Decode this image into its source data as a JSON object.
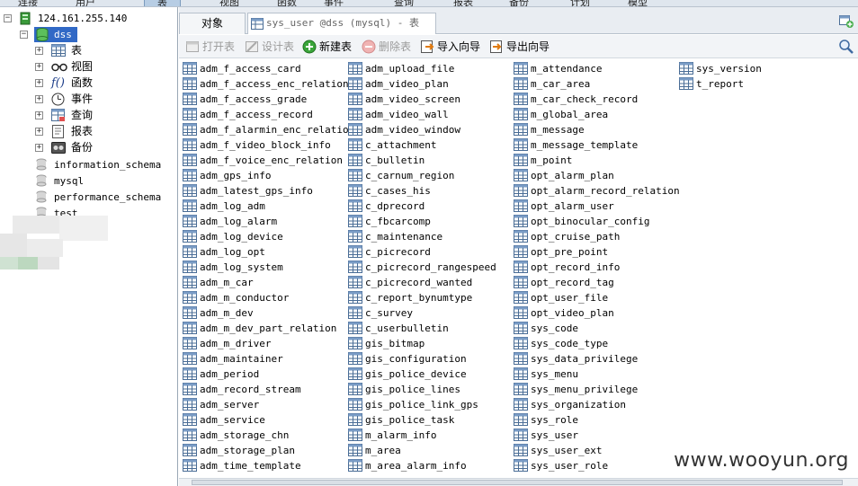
{
  "menu": [
    "连接",
    "用户",
    "表",
    "视图",
    "函数",
    "事件",
    "查询",
    "报表",
    "备份",
    "计划",
    "模型"
  ],
  "tree": {
    "server": "124.161.255.140",
    "database": "dss",
    "children": [
      "表",
      "视图",
      "函数",
      "事件",
      "查询",
      "报表",
      "备份"
    ],
    "other_dbs": [
      "information_schema",
      "mysql",
      "performance_schema",
      "test"
    ]
  },
  "tabs": {
    "objects": "对象",
    "active": "sys_user @dss (mysql) - 表"
  },
  "toolbar": {
    "open": "打开表",
    "design": "设计表",
    "new": "新建表",
    "delete": "删除表",
    "import": "导入向导",
    "export": "导出向导"
  },
  "columns": [
    [
      "adm_f_access_card",
      "adm_f_access_enc_relation",
      "adm_f_access_grade",
      "adm_f_access_record",
      "adm_f_alarmin_enc_relation",
      "adm_f_video_block_info",
      "adm_f_voice_enc_relation",
      "adm_gps_info",
      "adm_latest_gps_info",
      "adm_log_adm",
      "adm_log_alarm",
      "adm_log_device",
      "adm_log_opt",
      "adm_log_system",
      "adm_m_car",
      "adm_m_conductor",
      "adm_m_dev",
      "adm_m_dev_part_relation",
      "adm_m_driver",
      "adm_maintainer",
      "adm_period",
      "adm_record_stream",
      "adm_server",
      "adm_service",
      "adm_storage_chn",
      "adm_storage_plan",
      "adm_time_template"
    ],
    [
      "adm_upload_file",
      "adm_video_plan",
      "adm_video_screen",
      "adm_video_wall",
      "adm_video_window",
      "c_attachment",
      "c_bulletin",
      "c_carnum_region",
      "c_cases_his",
      "c_dprecord",
      "c_fbcarcomp",
      "c_maintenance",
      "c_picrecord",
      "c_picrecord_rangespeed",
      "c_picrecord_wanted",
      "c_report_bynumtype",
      "c_survey",
      "c_userbulletin",
      "gis_bitmap",
      "gis_configuration",
      "gis_police_device",
      "gis_police_lines",
      "gis_police_link_gps",
      "gis_police_task",
      "m_alarm_info",
      "m_area",
      "m_area_alarm_info"
    ],
    [
      "m_attendance",
      "m_car_area",
      "m_car_check_record",
      "m_global_area",
      "m_message",
      "m_message_template",
      "m_point",
      "opt_alarm_plan",
      "opt_alarm_record_relation",
      "opt_alarm_user",
      "opt_binocular_config",
      "opt_cruise_path",
      "opt_pre_point",
      "opt_record_info",
      "opt_record_tag",
      "opt_user_file",
      "opt_video_plan",
      "sys_code",
      "sys_code_type",
      "sys_data_privilege",
      "sys_menu",
      "sys_menu_privilege",
      "sys_organization",
      "sys_role",
      "sys_user",
      "sys_user_ext",
      "sys_user_role"
    ],
    [
      "sys_version",
      "t_report"
    ]
  ],
  "watermark": "www.wooyun.org"
}
